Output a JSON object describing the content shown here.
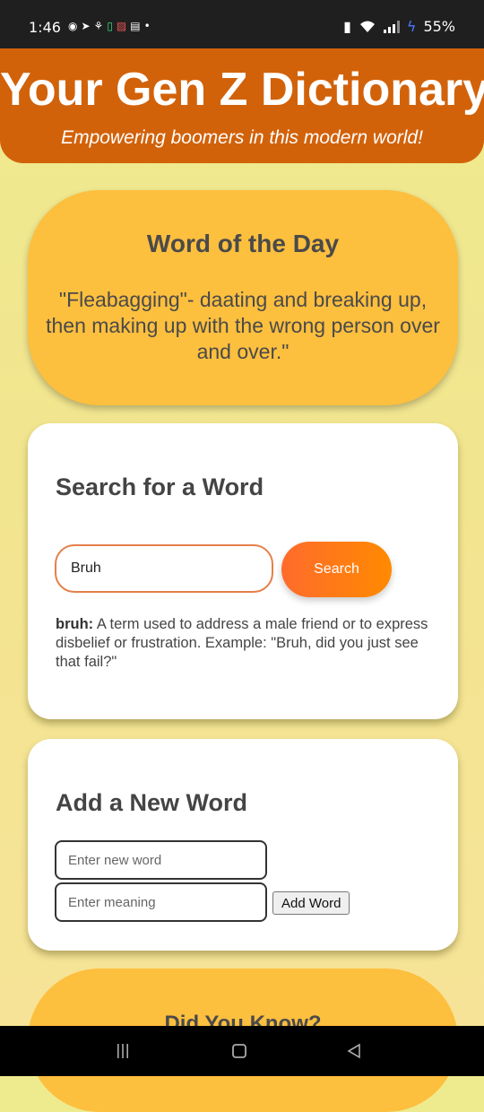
{
  "status": {
    "time": "1:46",
    "battery": "55%",
    "notif_icons": [
      "messenger-icon",
      "telegram-icon",
      "app-icon",
      "battery-saver-icon",
      "news-icon",
      "book-icon",
      "dot-icon"
    ]
  },
  "header": {
    "title": "Your Gen Z Dictionary",
    "subtitle": "Empowering boomers in this modern world!"
  },
  "word_of_day": {
    "heading": "Word of the Day",
    "text": "\"Fleabagging\"- daating and breaking up, then making up with the wrong person over and over.\""
  },
  "search": {
    "heading": "Search for a Word",
    "input_value": "Bruh",
    "button_label": "Search",
    "result_term": "bruh:",
    "result_text": " A term used to address a male friend or to express disbelief or frustration. Example: \"Bruh, did you just see that fail?\""
  },
  "add_word": {
    "heading": "Add a New Word",
    "word_placeholder": "Enter new word",
    "meaning_placeholder": "Enter meaning",
    "button_label": "Add Word"
  },
  "did_you_know": {
    "heading": "Did You Know?"
  },
  "colors": {
    "header": "#d2620a",
    "card_yellow": "#fdbf3e",
    "search_button": "#ff7a18",
    "search_border": "#e57f4a"
  }
}
